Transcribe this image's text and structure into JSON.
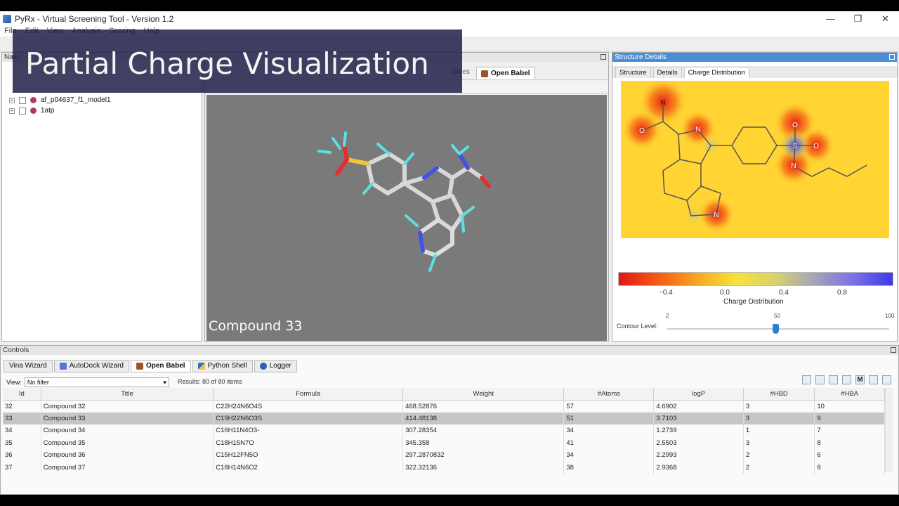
{
  "app": {
    "title": "PyRx - Virtual Screening Tool - Version 1.2"
  },
  "window_controls": {
    "minimize": "—",
    "restore": "❐",
    "close": "✕"
  },
  "menu": [
    "File",
    "Edit",
    "View",
    "Analysis",
    "Scoring",
    "Help"
  ],
  "banner": {
    "title": "Partial Charge Visualization"
  },
  "navigator": {
    "label": "Navi",
    "tree": [
      {
        "label": "af_p04637_f1_model1"
      },
      {
        "label": "1atp"
      }
    ]
  },
  "viewer": {
    "tabs_label": "Tables",
    "active_tab": "Open Babel",
    "compound_label": "Compound 33"
  },
  "details": {
    "header": "Structure Details",
    "tabs": [
      "Structure",
      "Details",
      "Charge Distribution"
    ],
    "colorbar": {
      "ticks": [
        "−0.4",
        "0.0",
        "0.4",
        "0.8"
      ],
      "title": "Charge Distribution",
      "stops": [
        "#e01717",
        "#f65a16",
        "#f7a722",
        "#f7e23b",
        "#d8d26c",
        "#a4a4b8",
        "#7a71e8",
        "#3f38e8"
      ]
    },
    "contour": {
      "label": "Contour Level:",
      "min": "2",
      "mid": "50",
      "max": "100",
      "value": 50
    },
    "atoms": {
      "N": "N",
      "O": "O",
      "S": "S"
    }
  },
  "controls": {
    "header": "Controls",
    "tabs": [
      "Vina Wizard",
      "AutoDock Wizard",
      "Open Babel",
      "Python Shell",
      "Logger"
    ],
    "active_tab": "Open Babel",
    "view_label": "View:",
    "filter_value": "No filter",
    "results": "Results: 80 of 80 items",
    "toolbar_m": "M"
  },
  "table": {
    "columns": [
      "Id",
      "Title",
      "Formula",
      "Weight",
      "#Atoms",
      "logP",
      "#HBD",
      "#HBA"
    ],
    "rows": [
      [
        "32",
        "Compound 32",
        "C22H24N6O4S",
        "468.52876",
        "57",
        "4.6902",
        "3",
        "10"
      ],
      [
        "33",
        "Compound 33",
        "C19H22N6O3S",
        "414.48138",
        "51",
        "3.7103",
        "3",
        "9"
      ],
      [
        "34",
        "Compound 34",
        "C16H11N4O3-",
        "307.28354",
        "34",
        "1.2739",
        "1",
        "7"
      ],
      [
        "35",
        "Compound 35",
        "C18H15N7O",
        "345.358",
        "41",
        "2.5503",
        "3",
        "8"
      ],
      [
        "36",
        "Compound 36",
        "C15H12FN5O",
        "297.2870832",
        "34",
        "2.2993",
        "2",
        "6"
      ],
      [
        "37",
        "Compound 37",
        "C18H14N6O2",
        "322.32136",
        "38",
        "2.9368",
        "2",
        "8"
      ]
    ],
    "selected_row": 1
  }
}
